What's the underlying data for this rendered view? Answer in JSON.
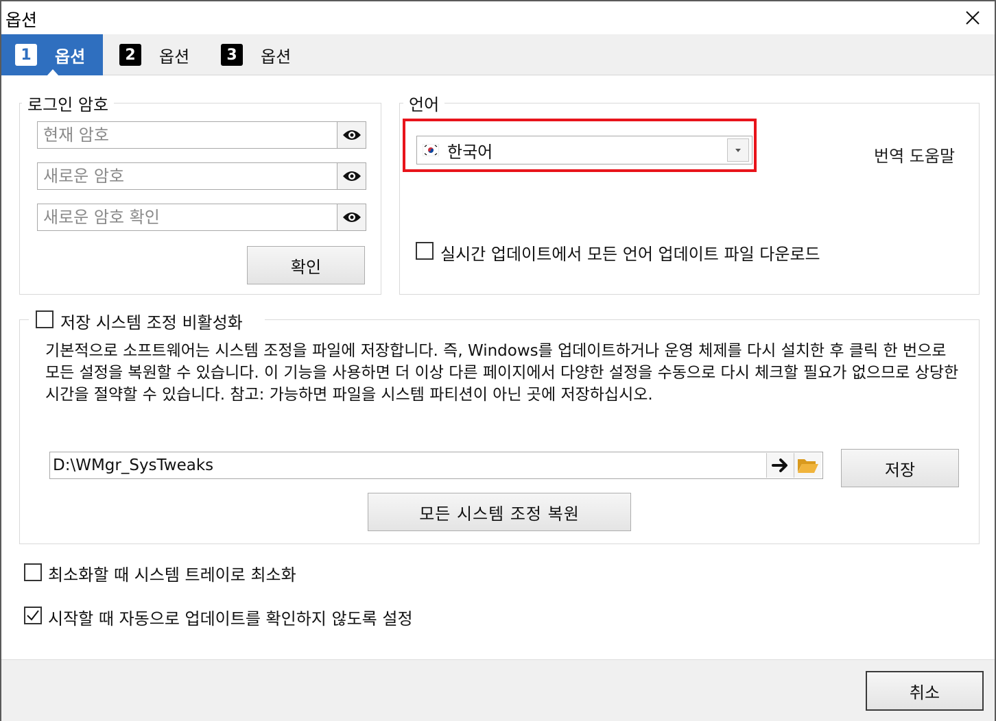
{
  "window": {
    "title": "옵션",
    "close_glyph": "✕"
  },
  "tabs": [
    {
      "num": "1",
      "label": "옵션",
      "active": true
    },
    {
      "num": "2",
      "label": "옵션",
      "active": false
    },
    {
      "num": "3",
      "label": "옵션",
      "active": false
    }
  ],
  "login_password": {
    "legend": "로그인 암호",
    "current_placeholder": "현재 암호",
    "new_placeholder": "새로운 암호",
    "confirm_new_placeholder": "새로운 암호 확인",
    "confirm_button": "확인"
  },
  "language": {
    "legend": "언어",
    "selected": "한국어",
    "translation_help": "번역 도움말",
    "download_all_label": "실시간 업데이트에서 모든 언어 업데이트 파일 다운로드",
    "download_all_checked": false
  },
  "save_tweaks": {
    "legend_checkbox_label": "저장 시스템 조정 비활성화",
    "checked": false,
    "description": "기본적으로 소프트웨어는 시스템 조정을 파일에 저장합니다. 즉, Windows를 업데이트하거나 운영 체제를 다시 설치한 후 클릭 한 번으로 모든 설정을 복원할 수 있습니다. 이 기능을 사용하면 더 이상 다른 페이지에서 다양한 설정을 수동으로 다시 체크할 필요가 없으므로 상당한 시간을 절약할 수 있습니다. 참고: 가능하면 파일을 시스템 파티션이 아닌 곳에 저장하십시오.",
    "path": "D:\\WMgr_SysTweaks",
    "save_button": "저장",
    "restore_button": "모든 시스템 조정 복원"
  },
  "options": {
    "minimize_to_tray_label": "최소화할 때 시스템 트레이로 최소화",
    "minimize_to_tray_checked": false,
    "no_auto_update_label": "시작할 때 자동으로 업데이트를 확인하지 않도록 설정",
    "no_auto_update_checked": true
  },
  "footer": {
    "cancel_button": "취소"
  },
  "colors": {
    "tab_active": "#2f6fbf",
    "highlight": "#e8141b",
    "folder": "#f0b43c"
  }
}
